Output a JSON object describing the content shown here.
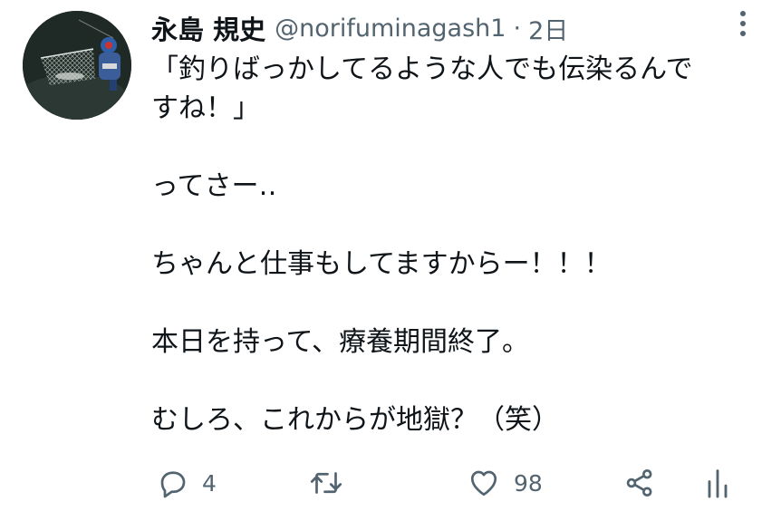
{
  "user": {
    "display_name": "永島 規史",
    "handle": "@norifuminagash1",
    "separator": "·",
    "time": "2日"
  },
  "tweet": {
    "lines": [
      "「釣りばっかしてるような人でも伝染るんで",
      "すね！」",
      "",
      "ってさー‥",
      "",
      "ちゃんと仕事もしてますからー！！！",
      "",
      "本日を持って、療養期間終了。",
      "",
      "むしろ、これからが地獄？（笑）"
    ]
  },
  "actions": {
    "reply_count": "4",
    "retweet_count": "",
    "like_count": "98"
  },
  "icons": {
    "reply": "reply-icon",
    "retweet": "retweet-icon",
    "like": "heart-icon",
    "share": "share-icon",
    "analytics": "analytics-icon",
    "more": "more-vertical-icon"
  },
  "colors": {
    "text": "#0f1419",
    "secondary": "#536471",
    "background": "#ffffff"
  }
}
